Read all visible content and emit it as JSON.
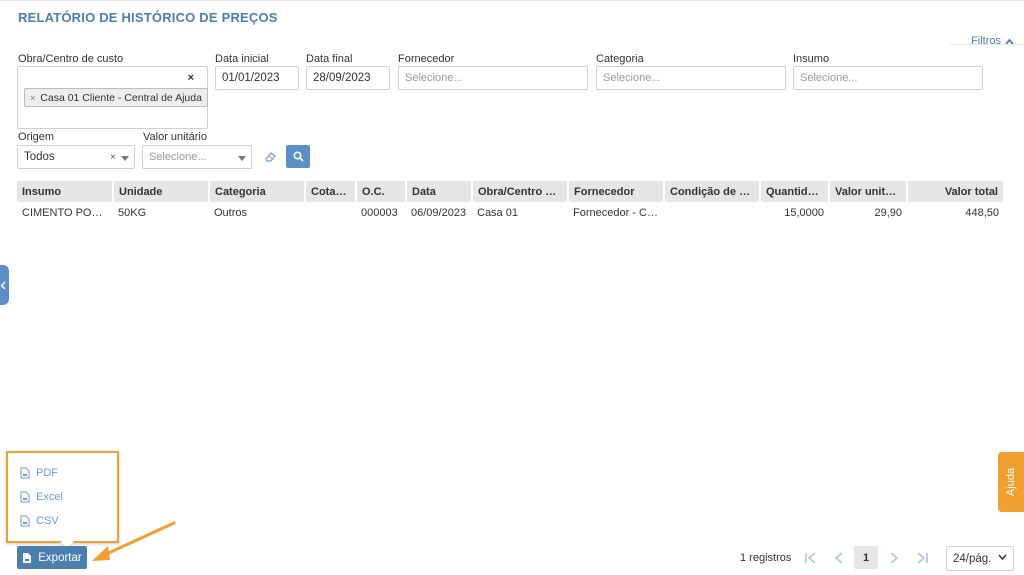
{
  "page": {
    "title": "RELATÓRIO DE HISTÓRICO DE PREÇOS"
  },
  "filters": {
    "toggle_label": "Filtros",
    "obra": {
      "label": "Obra/Centro de custo",
      "clear": "×",
      "chip": "Casa 01 Cliente - Central de Ajuda",
      "chip_remove": "×"
    },
    "data_inicial": {
      "label": "Data inicial",
      "value": "01/01/2023"
    },
    "data_final": {
      "label": "Data final",
      "value": "28/09/2023"
    },
    "fornecedor": {
      "label": "Fornecedor",
      "placeholder": "Selecione..."
    },
    "categoria": {
      "label": "Categoria",
      "placeholder": "Selecione..."
    },
    "insumo": {
      "label": "Insumo",
      "placeholder": "Selecione..."
    },
    "origem": {
      "label": "Origem",
      "value": "Todos",
      "clear": "×"
    },
    "valor_unitario": {
      "label": "Valor unitário",
      "placeholder": "Selecione..."
    }
  },
  "table": {
    "headers": [
      "Insumo",
      "Unidade",
      "Categoria",
      "Cotação",
      "O.C.",
      "Data",
      "Obra/Centro de custo",
      "Fornecedor",
      "Condição de pagamento",
      "Quantidade",
      "Valor unitário",
      "Valor total"
    ],
    "rows": [
      [
        "CIMENTO PORTLAND",
        "50KG",
        "Outros",
        "",
        "000003",
        "06/09/2023",
        "Casa 01",
        "Fornecedor - Central de Ajuda",
        "",
        "15,0000",
        "29,90",
        "448,50"
      ]
    ]
  },
  "export": {
    "button_label": "Exportar",
    "menu": [
      {
        "label": "PDF",
        "icon": "file-icon"
      },
      {
        "label": "Excel",
        "icon": "file-icon"
      },
      {
        "label": "CSV",
        "icon": "file-icon"
      }
    ]
  },
  "pagination": {
    "records": "1 registros",
    "current_page": "1",
    "per_page": "24/pág."
  },
  "help": {
    "label": "Ajuda"
  },
  "colors": {
    "accent": "#4a7fb0",
    "highlight": "#f0a030",
    "header_bg": "#e6e6e6"
  }
}
